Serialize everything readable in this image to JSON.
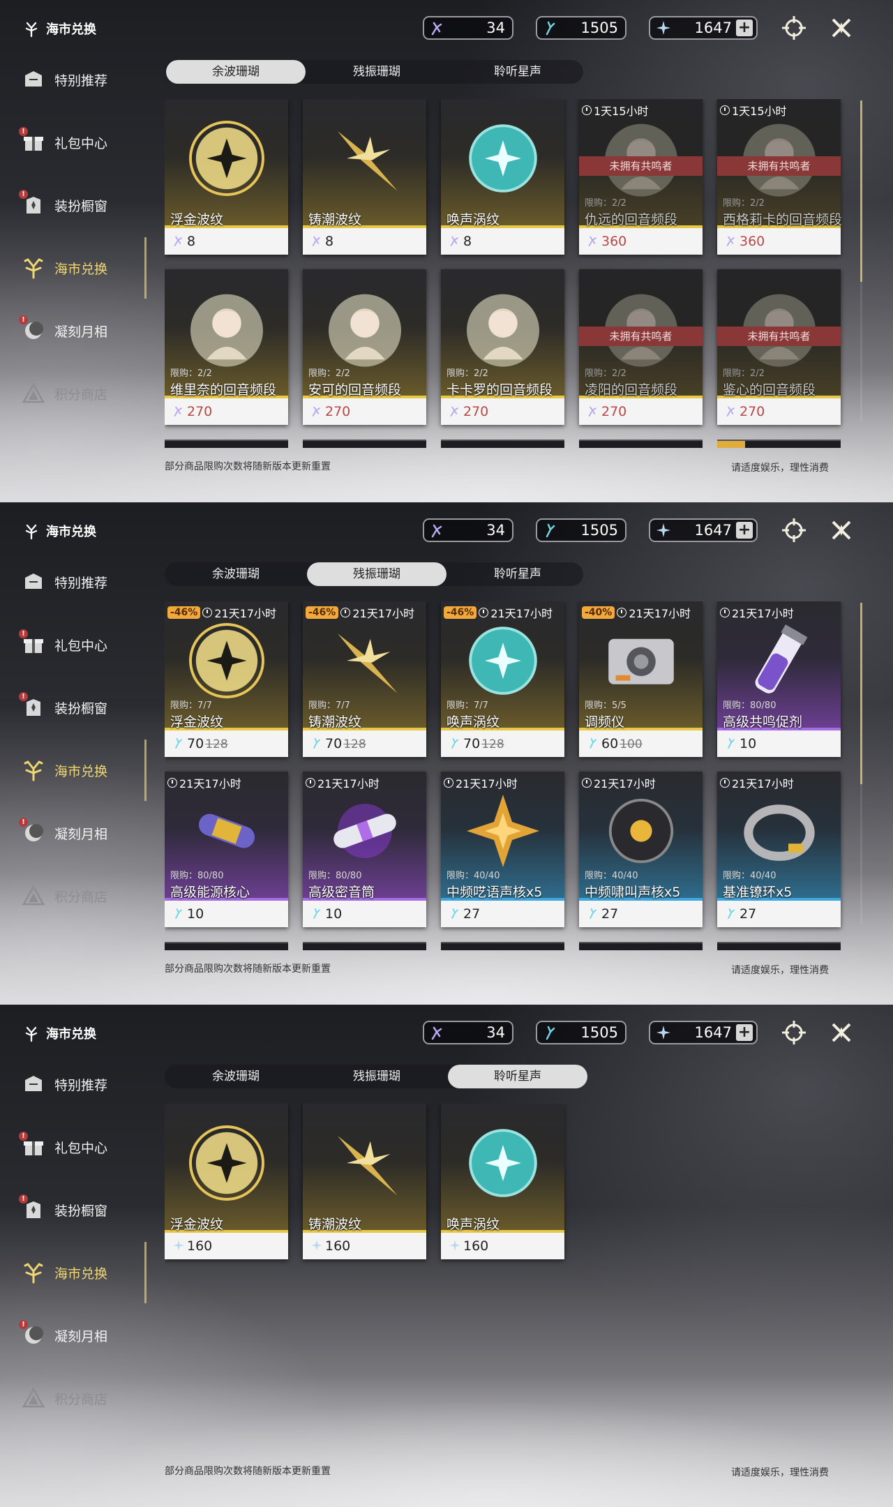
{
  "colors": {
    "accent_gold": "#f0d774",
    "gold_rarity": "#e7c84a",
    "purple_rarity": "#a56de0",
    "blue_rarity": "#3fa7de",
    "locked_red": "#8a3737",
    "discount": "#f0a93a"
  },
  "screens": [
    {
      "title": "海市兑换",
      "currencies": [
        {
          "icon": "coral-purple-icon",
          "value": "34"
        },
        {
          "icon": "coral-blue-icon",
          "value": "1505"
        },
        {
          "icon": "star-shard-icon",
          "value": "1647",
          "plus": "+"
        }
      ],
      "nav": [
        "特别推荐",
        "礼包中心",
        "装扮橱窗",
        "海市兑换",
        "凝刻月相",
        "积分商店"
      ],
      "tabs": [
        "余波珊瑚",
        "残振珊瑚",
        "聆听星声"
      ],
      "selected_tab": 0,
      "note": "部分商品限购次数将随新版本更新重置",
      "note_right": "请适度娱乐，理性消费",
      "cards": [
        {
          "name": "浮金波纹",
          "price": "8",
          "rarity": "gold",
          "art": "orb-gold-icon"
        },
        {
          "name": "铸潮波纹",
          "price": "8",
          "rarity": "gold",
          "art": "dagger-gold-icon"
        },
        {
          "name": "唤声涡纹",
          "price": "8",
          "rarity": "gold",
          "art": "orb-teal-icon"
        },
        {
          "name": "仇远的回音频段",
          "price": "360",
          "rarity": "gold",
          "timer": "1天15小时",
          "limit": "限购：2/2",
          "locked": "未拥有共鸣者",
          "art": "portrait-icon",
          "price_red": true
        },
        {
          "name": "西格莉卡的回音频段",
          "price": "360",
          "rarity": "gold",
          "timer": "1天15小时",
          "limit": "限购：2/2",
          "locked": "未拥有共鸣者",
          "art": "portrait-icon",
          "price_red": true
        },
        {
          "name": "维里奈的回音频段",
          "price": "270",
          "rarity": "gold",
          "limit": "限购：2/2",
          "art": "portrait-icon",
          "price_red": true
        },
        {
          "name": "安可的回音频段",
          "price": "270",
          "rarity": "gold",
          "limit": "限购：2/2",
          "art": "portrait-icon",
          "price_red": true
        },
        {
          "name": "卡卡罗的回音频段",
          "price": "270",
          "rarity": "gold",
          "limit": "限购：2/2",
          "art": "portrait-icon",
          "price_red": true
        },
        {
          "name": "凌阳的回音频段",
          "price": "270",
          "rarity": "gold",
          "limit": "限购：2/2",
          "locked": "未拥有共鸣者",
          "art": "portrait-icon",
          "price_red": true
        },
        {
          "name": "鉴心的回音频段",
          "price": "270",
          "rarity": "gold",
          "limit": "限购：2/2",
          "locked": "未拥有共鸣者",
          "art": "portrait-icon",
          "price_red": true
        }
      ]
    },
    {
      "title": "海市兑换",
      "currencies": [
        {
          "icon": "coral-purple-icon",
          "value": "34"
        },
        {
          "icon": "coral-blue-icon",
          "value": "1505"
        },
        {
          "icon": "star-shard-icon",
          "value": "1647",
          "plus": "+"
        }
      ],
      "nav": [
        "特别推荐",
        "礼包中心",
        "装扮橱窗",
        "海市兑换",
        "凝刻月相",
        "积分商店"
      ],
      "tabs": [
        "余波珊瑚",
        "残振珊瑚",
        "聆听星声"
      ],
      "selected_tab": 1,
      "note": "部分商品限购次数将随新版本更新重置",
      "note_right": "请适度娱乐，理性消费",
      "cards": [
        {
          "name": "浮金波纹",
          "price": "70",
          "old_price": "128",
          "discount": "-46%",
          "timer": "21天17小时",
          "limit": "限购：7/7",
          "rarity": "gold",
          "art": "orb-gold-icon"
        },
        {
          "name": "铸潮波纹",
          "price": "70",
          "old_price": "128",
          "discount": "-46%",
          "timer": "21天17小时",
          "limit": "限购：7/7",
          "rarity": "gold",
          "art": "dagger-gold-icon"
        },
        {
          "name": "唤声涡纹",
          "price": "70",
          "old_price": "128",
          "discount": "-46%",
          "timer": "21天17小时",
          "limit": "限购：7/7",
          "rarity": "gold",
          "art": "orb-teal-icon"
        },
        {
          "name": "调频仪",
          "price": "60",
          "old_price": "100",
          "discount": "-40%",
          "timer": "21天17小时",
          "limit": "限购：5/5",
          "rarity": "gold",
          "art": "device-icon"
        },
        {
          "name": "高级共鸣促剂",
          "price": "10",
          "timer": "21天17小时",
          "limit": "限购：80/80",
          "rarity": "purple",
          "art": "vial-icon"
        },
        {
          "name": "高级能源核心",
          "price": "10",
          "timer": "21天17小时",
          "limit": "限购：80/80",
          "rarity": "purple",
          "art": "capsule-icon"
        },
        {
          "name": "高级密音筒",
          "price": "10",
          "timer": "21天17小时",
          "limit": "限购：80/80",
          "rarity": "purple",
          "art": "cylinder-icon"
        },
        {
          "name": "中频呓语声核x5",
          "price": "27",
          "timer": "21天17小时",
          "limit": "限购：40/40",
          "rarity": "blue",
          "art": "star-core-icon"
        },
        {
          "name": "中频啸叫声核x5",
          "price": "27",
          "timer": "21天17小时",
          "limit": "限购：40/40",
          "rarity": "blue",
          "art": "flower-core-icon"
        },
        {
          "name": "基准镣环x5",
          "price": "27",
          "timer": "21天17小时",
          "limit": "限购：40/40",
          "rarity": "blue",
          "art": "ring-icon"
        }
      ]
    },
    {
      "title": "海市兑换",
      "currencies": [
        {
          "icon": "coral-purple-icon",
          "value": "34"
        },
        {
          "icon": "coral-blue-icon",
          "value": "1505"
        },
        {
          "icon": "star-shard-icon",
          "value": "1647",
          "plus": "+"
        }
      ],
      "nav": [
        "特别推荐",
        "礼包中心",
        "装扮橱窗",
        "海市兑换",
        "凝刻月相",
        "积分商店"
      ],
      "tabs": [
        "余波珊瑚",
        "残振珊瑚",
        "聆听星声"
      ],
      "selected_tab": 2,
      "note": "部分商品限购次数将随新版本更新重置",
      "note_right": "请适度娱乐，理性消费",
      "cards": [
        {
          "name": "浮金波纹",
          "price": "160",
          "rarity": "gold",
          "art": "orb-gold-icon"
        },
        {
          "name": "铸潮波纹",
          "price": "160",
          "rarity": "gold",
          "art": "dagger-gold-icon"
        },
        {
          "name": "唤声涡纹",
          "price": "160",
          "rarity": "gold",
          "art": "orb-teal-icon"
        }
      ]
    }
  ]
}
